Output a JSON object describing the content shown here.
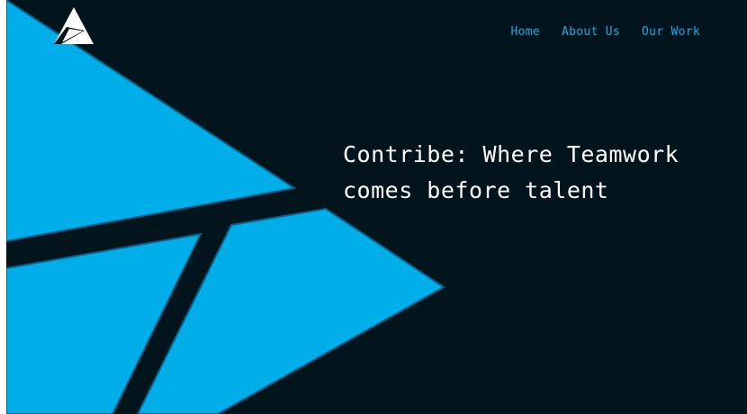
{
  "brand": {
    "logo_icon": "triangle-logo-icon",
    "accent_color": "#00afe9",
    "background_color": "#02141c"
  },
  "nav": {
    "items": [
      {
        "label": "Home"
      },
      {
        "label": "About Us"
      },
      {
        "label": "Our Work"
      }
    ]
  },
  "hero": {
    "headline": "Contribe: Where Teamwork comes before talent"
  }
}
